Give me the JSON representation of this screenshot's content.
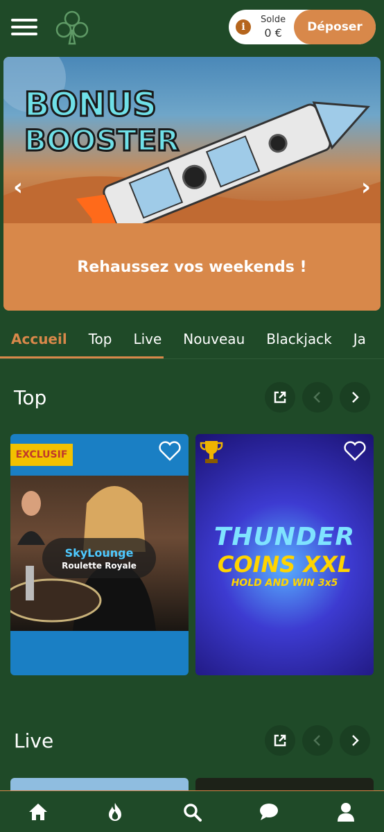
{
  "header": {
    "balance_label": "Solde",
    "balance_value": "0 €",
    "deposit_label": "Déposer",
    "info_glyph": "i"
  },
  "banner": {
    "caption": "Rehaussez vos weekends !",
    "prev_glyph": "‹",
    "next_glyph": "›"
  },
  "tabs": [
    "Accueil",
    "Top",
    "Live",
    "Nouveau",
    "Blackjack",
    "Ja"
  ],
  "sections": {
    "top": {
      "title": "Top"
    },
    "live": {
      "title": "Live"
    }
  },
  "cards": {
    "card1": {
      "badge": "EXCLUSIF",
      "brand": "SkyLounge",
      "subtitle": "Roulette Royale"
    },
    "card2": {
      "line1": "THUNDER",
      "line2": "COINS XXL",
      "line3": "HOLD AND WIN 3x5"
    }
  },
  "colors": {
    "background": "#1f4a28",
    "accent": "#d8884a",
    "badge": "#f2c100"
  },
  "icons": [
    "menu-icon",
    "clover-logo",
    "info-icon",
    "external-link-icon",
    "chevron-left-icon",
    "chevron-right-icon",
    "heart-icon",
    "trophy-icon",
    "home-icon",
    "flame-icon",
    "search-icon",
    "chat-icon",
    "user-icon"
  ]
}
